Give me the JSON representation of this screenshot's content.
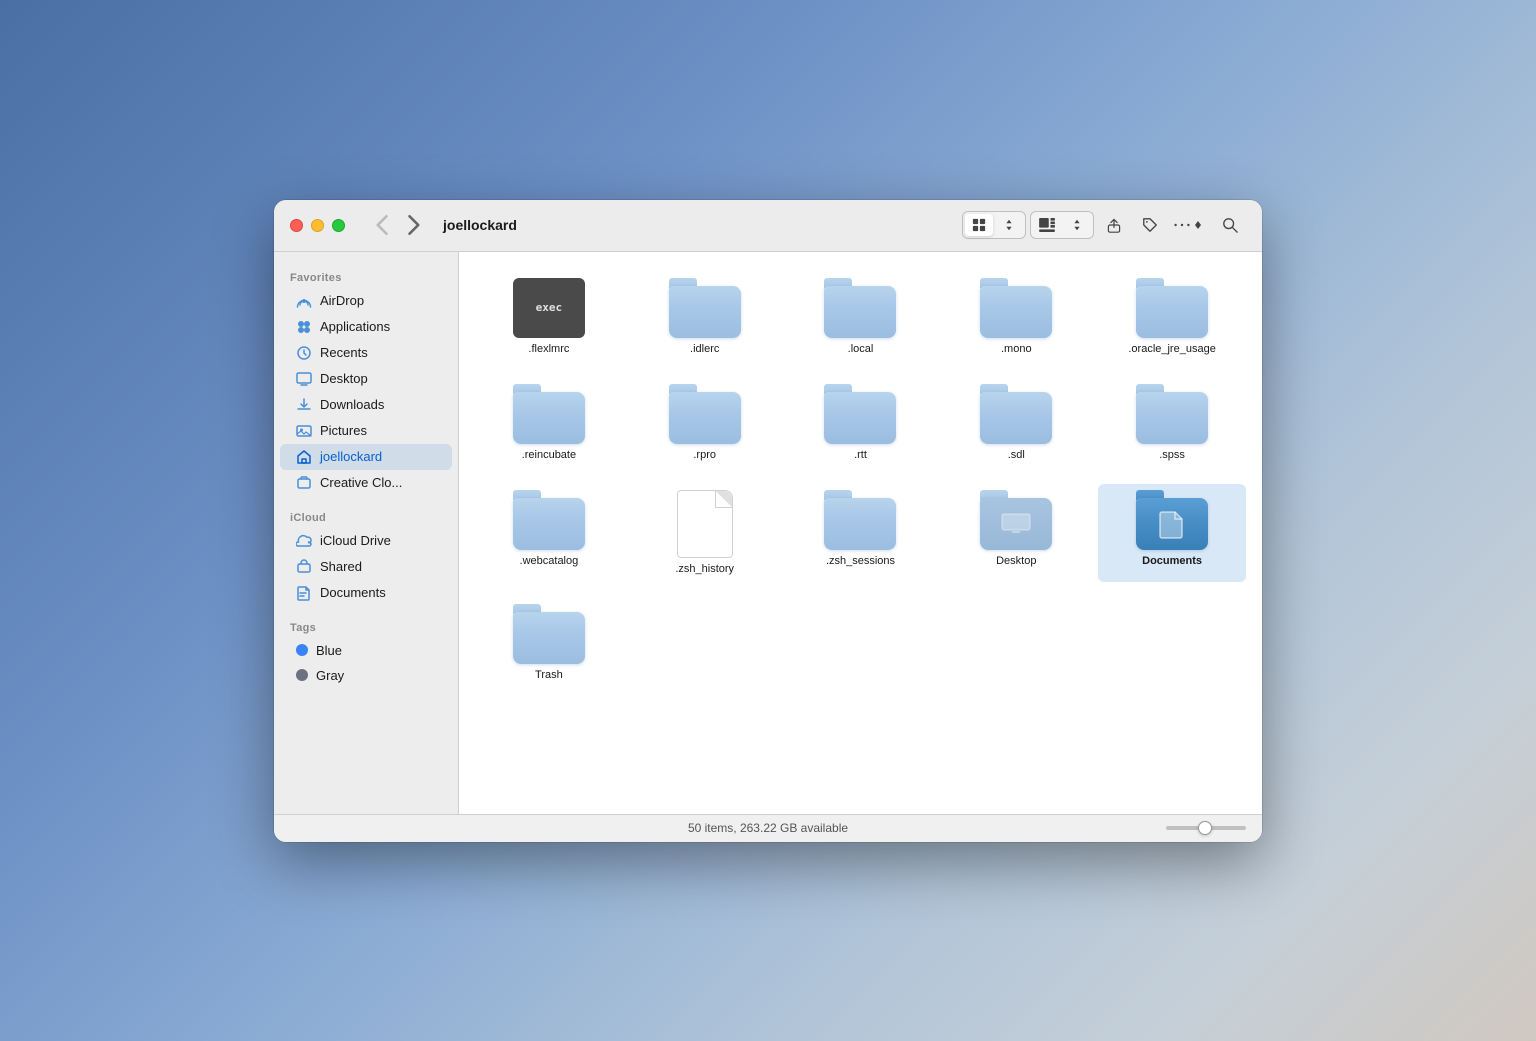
{
  "window": {
    "title": "joellockard"
  },
  "sidebar": {
    "favorites_label": "Favorites",
    "icloud_label": "iCloud",
    "tags_label": "Tags",
    "items_favorites": [
      {
        "id": "airdrop",
        "label": "AirDrop",
        "icon": "airdrop"
      },
      {
        "id": "applications",
        "label": "Applications",
        "icon": "applications"
      },
      {
        "id": "recents",
        "label": "Recents",
        "icon": "recents"
      },
      {
        "id": "desktop",
        "label": "Desktop",
        "icon": "desktop"
      },
      {
        "id": "downloads",
        "label": "Downloads",
        "icon": "downloads"
      },
      {
        "id": "pictures",
        "label": "Pictures",
        "icon": "pictures"
      },
      {
        "id": "joellockard",
        "label": "joellockard",
        "icon": "home",
        "active": true
      },
      {
        "id": "creative-clo",
        "label": "Creative Clo...",
        "icon": "folder"
      }
    ],
    "items_icloud": [
      {
        "id": "icloud-drive",
        "label": "iCloud Drive",
        "icon": "icloud"
      },
      {
        "id": "shared",
        "label": "Shared",
        "icon": "shared"
      },
      {
        "id": "documents",
        "label": "Documents",
        "icon": "documents"
      }
    ],
    "items_tags": [
      {
        "id": "blue",
        "label": "Blue",
        "color": "#3b82f6"
      },
      {
        "id": "gray",
        "label": "Gray",
        "color": "#6b7280"
      }
    ]
  },
  "toolbar": {
    "back_label": "‹",
    "forward_label": "›",
    "view_icon_label": "⊞",
    "status": "50 items, 263.22 GB available"
  },
  "files": [
    {
      "id": "flexlmrc",
      "name": ".flexlmrc",
      "type": "exec"
    },
    {
      "id": "idlerc",
      "name": ".idlerc",
      "type": "folder"
    },
    {
      "id": "local",
      "name": ".local",
      "type": "folder"
    },
    {
      "id": "mono",
      "name": ".mono",
      "type": "folder"
    },
    {
      "id": "oracle_jre_usage",
      "name": ".oracle_jre_usage",
      "type": "folder"
    },
    {
      "id": "reincubate",
      "name": ".reincubate",
      "type": "folder"
    },
    {
      "id": "rpro",
      "name": ".rpro",
      "type": "folder"
    },
    {
      "id": "rtt",
      "name": ".rtt",
      "type": "folder"
    },
    {
      "id": "sdl",
      "name": ".sdl",
      "type": "folder"
    },
    {
      "id": "spss",
      "name": ".spss",
      "type": "folder"
    },
    {
      "id": "webcatalog",
      "name": ".webcatalog",
      "type": "folder"
    },
    {
      "id": "zsh_history",
      "name": ".zsh_history",
      "type": "file"
    },
    {
      "id": "zsh_sessions",
      "name": ".zsh_sessions",
      "type": "folder"
    },
    {
      "id": "desktop-folder",
      "name": "Desktop",
      "type": "folder-desktop"
    },
    {
      "id": "documents-folder",
      "name": "Documents",
      "type": "folder-dark",
      "bold": true
    },
    {
      "id": "trash",
      "name": "Trash",
      "type": "folder"
    }
  ]
}
